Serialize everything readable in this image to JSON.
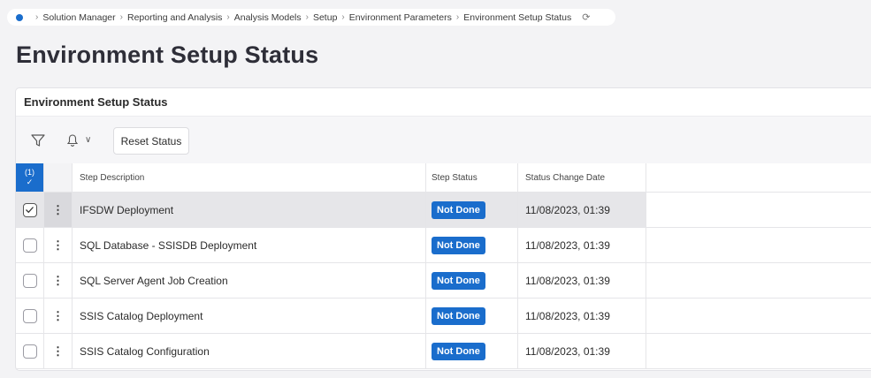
{
  "breadcrumb": {
    "items": [
      "Solution Manager",
      "Reporting and Analysis",
      "Analysis Models",
      "Setup",
      "Environment Parameters",
      "Environment Setup Status"
    ]
  },
  "page_title": "Environment Setup Status",
  "panel": {
    "title": "Environment Setup Status",
    "toolbar": {
      "reset_label": "Reset Status"
    }
  },
  "table": {
    "selection_count": "(1)",
    "columns": [
      "Step Description",
      "Step Status",
      "Status Change Date"
    ],
    "rows": [
      {
        "description": "IFSDW Deployment",
        "status": "Not Done",
        "date": "11/08/2023, 01:39",
        "selected": true
      },
      {
        "description": "SQL Database - SSISDB Deployment",
        "status": "Not Done",
        "date": "11/08/2023, 01:39",
        "selected": false
      },
      {
        "description": "SQL Server Agent Job Creation",
        "status": "Not Done",
        "date": "11/08/2023, 01:39",
        "selected": false
      },
      {
        "description": "SSIS Catalog Deployment",
        "status": "Not Done",
        "date": "11/08/2023, 01:39",
        "selected": false
      },
      {
        "description": "SSIS Catalog Configuration",
        "status": "Not Done",
        "date": "11/08/2023, 01:39",
        "selected": false
      }
    ]
  },
  "colors": {
    "accent": "#1a6dcc",
    "selected_row": "#e6e6e9"
  },
  "icons": {
    "home": "home-dot-icon",
    "refresh": "refresh-icon",
    "filter": "filter-icon",
    "notify": "bell-icon",
    "row_menu": "kebab-icon"
  }
}
